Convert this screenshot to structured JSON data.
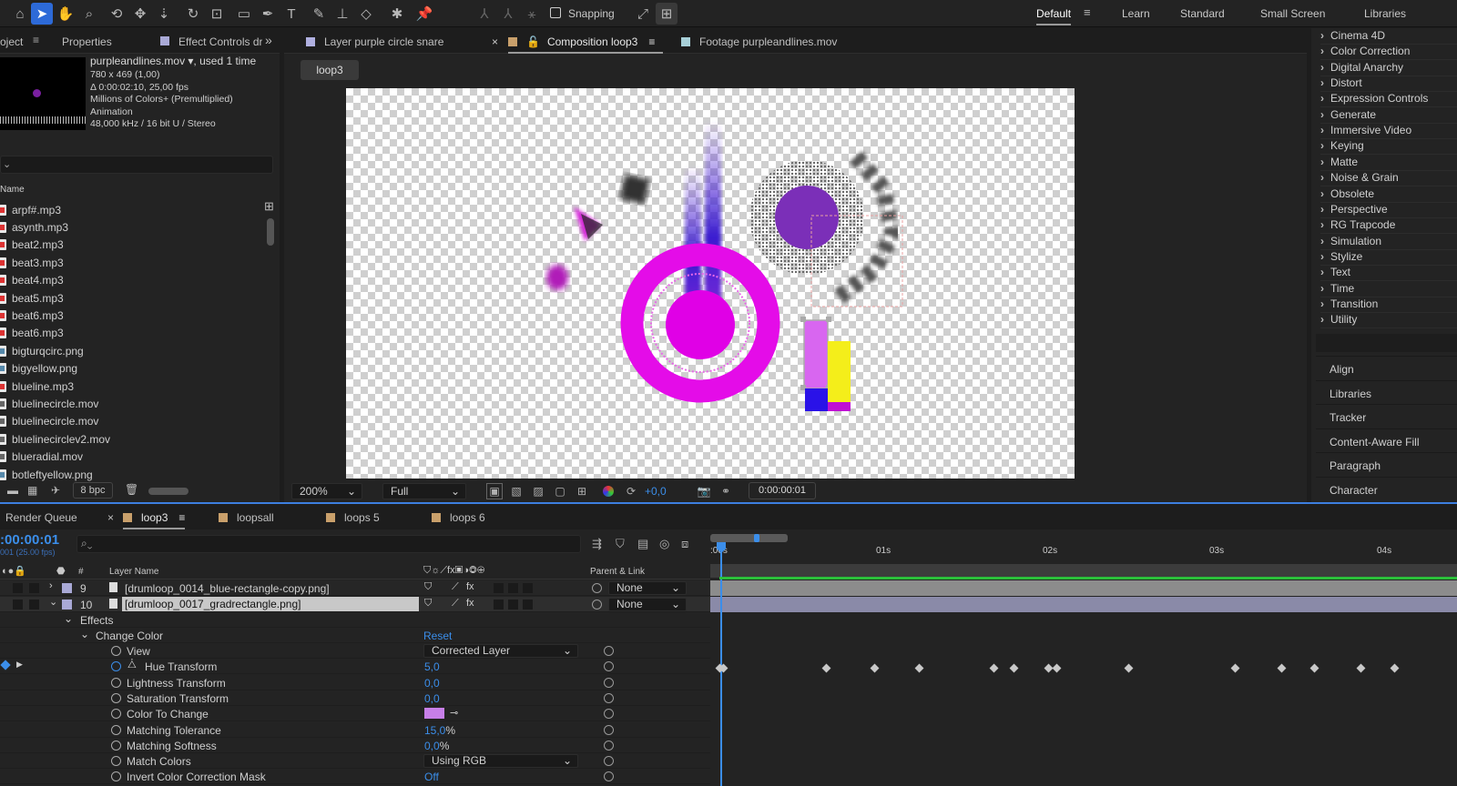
{
  "toolbar": {
    "snapping_label": "Snapping"
  },
  "workspaces": [
    "Default",
    "Learn",
    "Standard",
    "Small Screen",
    "Libraries"
  ],
  "project_panel": {
    "tabs": [
      "oject",
      "Properties",
      "Effect Controls dr",
      "»"
    ],
    "footage_name": "purpleandlines.mov ▾",
    "used": ", used 1 time",
    "info": [
      "780 x 469 (1,00)",
      "Δ 0:00:02:10, 25,00 fps",
      "Millions of Colors+ (Premultiplied)",
      "Animation",
      "48,000 kHz / 16 bit U / Stereo"
    ],
    "name_header": "Name",
    "files": [
      "arpf#.mp3",
      "asynth.mp3",
      "beat2.mp3",
      "beat3.mp3",
      "beat4.mp3",
      "beat5.mp3",
      "beat6.mp3",
      "beat6.mp3",
      "bigturqcirc.png",
      "bigyellow.png",
      "blueline.mp3",
      "bluelinecircle.mov",
      "bluelinecircle.mov",
      "bluelinecirclev2.mov",
      "blueradial.mov",
      "botleftyellow.png"
    ],
    "bpc": "8 bpc"
  },
  "viewer": {
    "tabs": [
      "Layer purple circle snare",
      "Composition loop3",
      "Footage purpleandlines.mov"
    ],
    "comp_button": "loop3",
    "zoom": "200%",
    "resolution": "Full",
    "exposure": "+0,0",
    "timecode": "0:00:00:01"
  },
  "effects_list": [
    "Cinema 4D",
    "Color Correction",
    "Digital Anarchy",
    "Distort",
    "Expression Controls",
    "Generate",
    "Immersive Video",
    "Keying",
    "Matte",
    "Noise & Grain",
    "Obsolete",
    "Perspective",
    "RG Trapcode",
    "Simulation",
    "Stylize",
    "Text",
    "Time",
    "Transition",
    "Utility"
  ],
  "side_panels": [
    "Align",
    "Libraries",
    "Tracker",
    "Content-Aware Fill",
    "Paragraph",
    "Character"
  ],
  "timeline": {
    "tabs": [
      "Render Queue",
      "loop3",
      "loopsall",
      "loops 5",
      "loops 6"
    ],
    "current_time": ":00:00:01",
    "frame_info": "001 (25.00 fps)",
    "col_layer_name": "Layer Name",
    "col_parent": "Parent & Link",
    "col_hash": "#",
    "ruler": [
      ":00s",
      "01s",
      "02s",
      "03s",
      "04s"
    ],
    "layers": [
      {
        "num": "9",
        "name": "[drumloop_0014_blue-rectangle-copy.png]",
        "parent": "None"
      },
      {
        "num": "10",
        "name": "[drumloop_0017_gradrectangle.png]",
        "parent": "None"
      }
    ],
    "effects_label": "Effects",
    "change_color_label": "Change Color",
    "reset_label": "Reset",
    "props": [
      {
        "name": "View",
        "value": "Corrected Layer"
      },
      {
        "name": "Hue Transform",
        "value": "5,0"
      },
      {
        "name": "Lightness Transform",
        "value": "0,0"
      },
      {
        "name": "Saturation Transform",
        "value": "0,0"
      },
      {
        "name": "Color To Change",
        "value": ""
      },
      {
        "name": "Matching Tolerance",
        "value": "15,0",
        "unit": "%"
      },
      {
        "name": "Matching Softness",
        "value": "0,0",
        "unit": "%"
      },
      {
        "name": "Match Colors",
        "value": "Using RGB"
      },
      {
        "name": "Invert Color Correction Mask",
        "value": "Off"
      }
    ],
    "color_to_change": "#c77fe8"
  },
  "colors": {
    "accent": "#2d6ad8",
    "blue_text": "#3b8eea",
    "workarea": "#5a5a5a",
    "green_bar": "#2bbf3a"
  }
}
